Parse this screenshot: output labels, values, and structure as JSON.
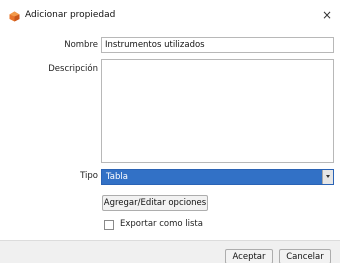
{
  "dialog": {
    "title": "Adicionar propiedad",
    "close_glyph": "×",
    "icon": "orange-gem-icon"
  },
  "form": {
    "nombre": {
      "label": "Nombre",
      "value": "Instrumentos utilizados"
    },
    "descripcion": {
      "label": "Descripción",
      "value": ""
    },
    "tipo": {
      "label": "Tipo",
      "selected": "Tabla"
    },
    "editar_opciones_label": "Agregar/Editar opciones",
    "exportar": {
      "label": "Exportar como lista",
      "checked": false
    }
  },
  "footer": {
    "aceptar_label": "Aceptar",
    "cancelar_label": "Cancelar"
  },
  "colors": {
    "selection": "#3271c6",
    "app_icon": "#e8742a"
  }
}
